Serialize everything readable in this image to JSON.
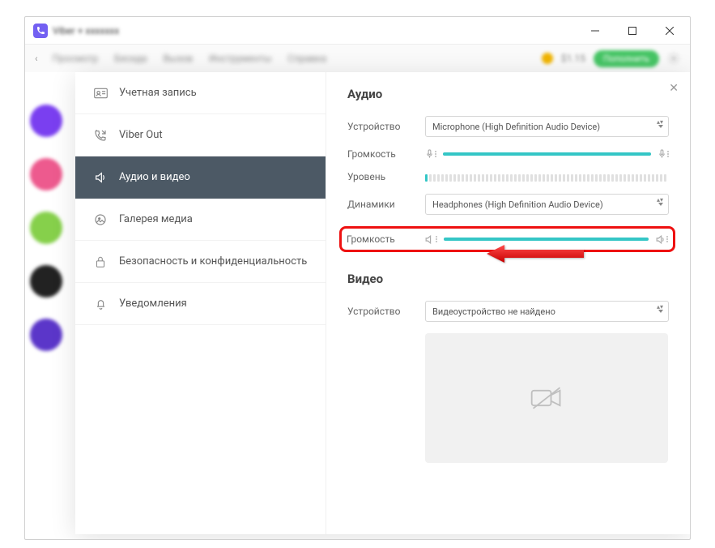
{
  "window": {
    "title_prefix": "Viber + ",
    "title_blurred": "xxxxxxx"
  },
  "appbar": {
    "menu": [
      "Просмотр",
      "Беседа",
      "Вызов",
      "Инструменты",
      "Справка"
    ],
    "balance": "$1.15",
    "cta": "Пополнить"
  },
  "sidebar": {
    "items": [
      {
        "label": "Учетная запись"
      },
      {
        "label": "Viber Out"
      },
      {
        "label": "Аудио и видео"
      },
      {
        "label": "Галерея медиа"
      },
      {
        "label": "Безопасность и конфиденциальность"
      },
      {
        "label": "Уведомления"
      }
    ]
  },
  "content": {
    "audio_heading": "Аудио",
    "video_heading": "Видео",
    "labels": {
      "device": "Устройство",
      "volume": "Громкость",
      "level": "Уровень",
      "speakers": "Динамики",
      "speaker_volume": "Громкость"
    },
    "mic_device": "Microphone (High Definition Audio Device)",
    "speaker_device": "Headphones (High Definition Audio Device)",
    "video_device": "Видеоустройство не найдено",
    "mic_volume_pct": 100,
    "speaker_volume_pct": 100,
    "level_active_bars": 1,
    "level_total_bars": 60
  }
}
